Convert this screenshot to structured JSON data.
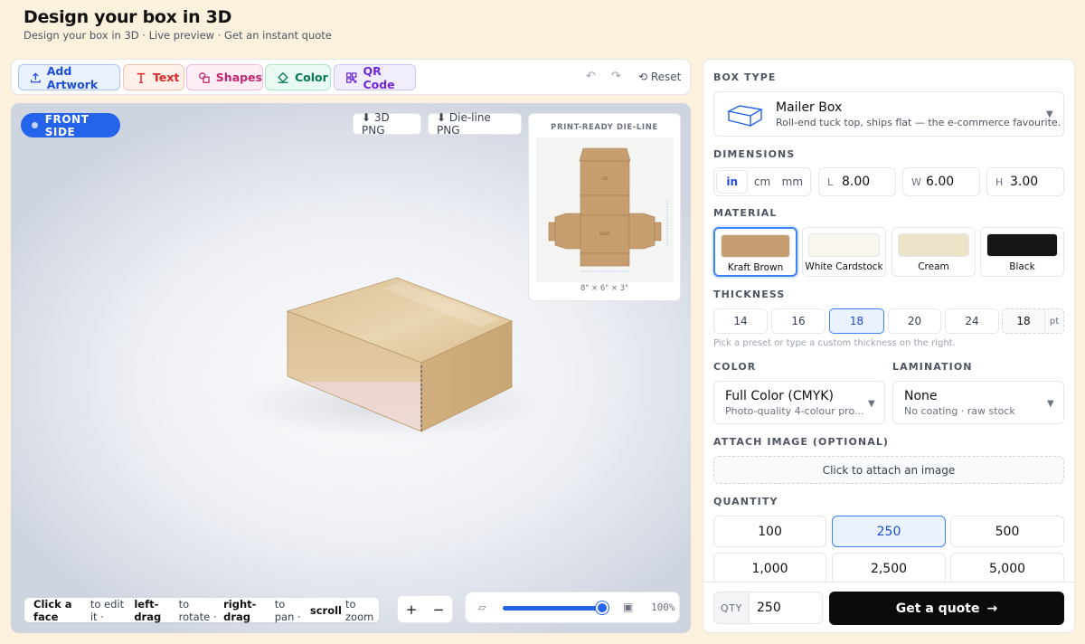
{
  "header": {
    "title": "Design your box in 3D",
    "subtitle": "Design your box in 3D · Live preview · Get an instant quote"
  },
  "toolbar": {
    "add_artwork": "Add Artwork",
    "text": "Text",
    "shapes": "Shapes",
    "color": "Color",
    "qr_code": "QR Code",
    "undo_glyph": "↶",
    "redo_glyph": "↷",
    "reset": "⟲ Reset"
  },
  "viewport": {
    "side_label": "FRONT SIDE",
    "download_3d": "⬇ 3D PNG",
    "download_dieline": "⬇ Die-line PNG",
    "dieline_title": "PRINT-READY DIE-LINE",
    "dieline_dims": "8\" × 6\" × 3\"",
    "dieline_lid_label": "LID",
    "dieline_base_label": "BASE",
    "hint": {
      "a_bold": "Click a face",
      "a_rest": "to edit it ·",
      "b_bold": "left-drag",
      "b_rest": "to rotate ·",
      "c_bold": "right-drag",
      "c_rest": "to pan ·",
      "d_bold": "scroll",
      "d_rest": "to zoom"
    },
    "zoom_in": "+",
    "zoom_out": "−",
    "zoom_small_icon": "▱",
    "zoom_large_icon": "▣",
    "zoom_level": "100%",
    "zoom_fraction": 1.0
  },
  "panel": {
    "box_type_heading": "BOX TYPE",
    "box_type_name": "Mailer Box",
    "box_type_desc": "Roll-end tuck top, ships flat — the e-commerce favourite.",
    "dimensions_heading": "DIMENSIONS",
    "units": [
      "in",
      "cm",
      "mm"
    ],
    "active_unit": "in",
    "dims": {
      "l_label": "L",
      "l_value": "8.00",
      "w_label": "W",
      "w_value": "6.00",
      "h_label": "H",
      "h_value": "3.00"
    },
    "material_heading": "MATERIAL",
    "materials": [
      {
        "label": "Kraft Brown",
        "color": "#c49e70"
      },
      {
        "label": "White Cardstock",
        "color": "#f8f6ef"
      },
      {
        "label": "Cream",
        "color": "#ede3c8"
      },
      {
        "label": "Black",
        "color": "#161616"
      }
    ],
    "selected_material": "Kraft Brown",
    "thickness_heading": "THICKNESS",
    "thickness_presets": [
      "14",
      "16",
      "18",
      "20",
      "24"
    ],
    "selected_thickness": "18",
    "custom_thickness": "18",
    "thickness_unit": "pt",
    "thickness_helper": "Pick a preset or type a custom thickness on the right.",
    "color_heading": "COLOR",
    "color_name": "Full Color (CMYK)",
    "color_desc": "Photo-quality 4-colour pro...",
    "lamination_heading": "LAMINATION",
    "lamination_name": "None",
    "lamination_desc": "No coating · raw stock",
    "attach_heading": "ATTACH IMAGE (OPTIONAL)",
    "attach_label": "Click to attach an image",
    "quantity_heading": "QUANTITY",
    "quantities": [
      "100",
      "250",
      "500",
      "1,000",
      "2,500",
      "5,000"
    ],
    "selected_quantity": "250",
    "footer_qty_label": "QTY",
    "footer_qty_value": "250",
    "quote_label": "Get a quote",
    "quote_arrow": "→"
  }
}
